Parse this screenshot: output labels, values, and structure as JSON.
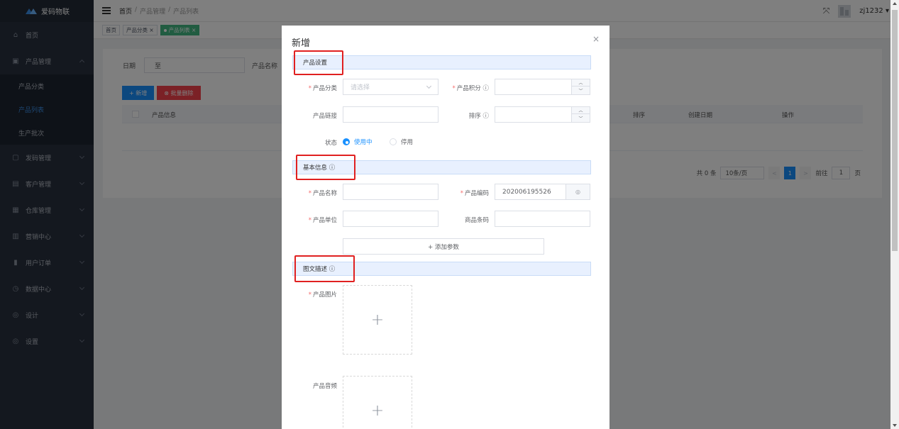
{
  "sidebar": {
    "brand": "爱码物联",
    "items": [
      {
        "label": "首页",
        "icon": "home-icon",
        "glyph": "⌂"
      },
      {
        "label": "产品管理",
        "icon": "box-icon",
        "glyph": "▣",
        "expanded": true
      },
      {
        "label": "发码管理",
        "icon": "code-icon",
        "glyph": "▢"
      },
      {
        "label": "客户管理",
        "icon": "customer-icon",
        "glyph": "▤"
      },
      {
        "label": "仓库管理",
        "icon": "warehouse-icon",
        "glyph": "▦"
      },
      {
        "label": "营销中心",
        "icon": "marketing-icon",
        "glyph": "▥"
      },
      {
        "label": "用户订单",
        "icon": "order-icon",
        "glyph": "▮"
      },
      {
        "label": "数据中心",
        "icon": "data-icon",
        "glyph": "◷"
      },
      {
        "label": "设计",
        "icon": "design-icon",
        "glyph": "◎"
      },
      {
        "label": "设置",
        "icon": "settings-icon",
        "glyph": "◎"
      }
    ],
    "subitems": [
      "产品分类",
      "产品列表",
      "生产批次"
    ]
  },
  "header": {
    "breadcrumb": [
      "首页",
      "/",
      "产品管理",
      "/",
      "产品列表"
    ],
    "username": "zj1232",
    "expand_glyph": "⤧",
    "dropdown_glyph": "▾"
  },
  "tags": [
    {
      "label": "首页"
    },
    {
      "label": "产品分类 ×"
    },
    {
      "label": "产品列表 ×",
      "active": true
    }
  ],
  "page": {
    "date_label": "日期",
    "date_sep": "至",
    "name_label": "产品名称",
    "add_button": "+ 新增",
    "batch_delete_button": "⊗ 批量删除",
    "columns": [
      "产品信息",
      "排序",
      "创建日期",
      "操作"
    ],
    "pager": {
      "total": "共 0 条",
      "page_size": "10条/页",
      "current": "1",
      "goto_label": "前往",
      "goto_value": "1",
      "page_unit": "页",
      "prev": "<",
      "next": ">"
    }
  },
  "dialog": {
    "title": "新增",
    "close": "×",
    "sections": {
      "product_settings": "产品设置",
      "basic_info": "基本信息 ⓘ",
      "description": "图文描述 ⓘ"
    },
    "fields": {
      "category_label": "产品分类",
      "category_placeholder": "请选择",
      "points_label": "产品积分 ⓘ",
      "link_label": "产品链接",
      "sort_label": "排序 ⓘ",
      "status_label": "状态",
      "status_on": "使用中",
      "status_off": "停用",
      "name_label": "产品名称",
      "code_label": "产品编码",
      "code_value": "202006195526",
      "unit_label": "产品单位",
      "barcode_label": "商品条码",
      "add_param": "+ 添加参数",
      "image_label": "产品图片",
      "audio_label": "产品音频",
      "upload_glyph": "+",
      "req": "*",
      "step_up": "︿",
      "step_down": "﹀",
      "code_suffix": "◎"
    }
  }
}
